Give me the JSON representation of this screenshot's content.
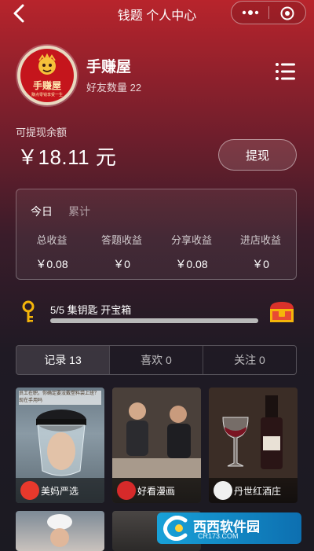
{
  "header": {
    "title": "钱题 个人中心"
  },
  "profile": {
    "avatar_text": "手赚屋",
    "avatar_subtext": "赚点零钱享受一生",
    "name": "手赚屋",
    "friends": "好友数量 22"
  },
  "balance": {
    "label": "可提现余额",
    "amount": "￥18.11 元",
    "withdraw_label": "提现"
  },
  "earnings": {
    "tabs": [
      "今日",
      "累计"
    ],
    "columns": [
      {
        "label": "总收益",
        "value": "￥0.08"
      },
      {
        "label": "答题收益",
        "value": "￥0"
      },
      {
        "label": "分享收益",
        "value": "￥0.08"
      },
      {
        "label": "进店收益",
        "value": "￥0"
      }
    ]
  },
  "keys": {
    "text": "5/5 集钥匙 开宝箱",
    "progress": 1.0
  },
  "tabs": [
    {
      "label": "记录 13"
    },
    {
      "label": "喜欢 0"
    },
    {
      "label": "关注 0"
    }
  ],
  "cards": [
    {
      "name": "美妈严选",
      "overlay": "员工在职，你确定要没戴塑料袋上班？现在手用吗"
    },
    {
      "name": "好看漫画"
    },
    {
      "name": "丹世红酒庄"
    }
  ],
  "watermark": {
    "text": "西西软件园",
    "url": "CR173.COM"
  },
  "colors": {
    "accent": "#c5151c",
    "card_bg": "#1f1a24"
  }
}
